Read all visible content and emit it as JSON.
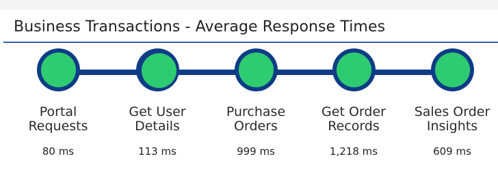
{
  "panel": {
    "title": "Business Transactions - Average Response Times"
  },
  "colors": {
    "accent_rule": "#2f5fa8",
    "node_ring": "#0f3c86",
    "node_fill": "#2ecc71"
  },
  "stages": [
    {
      "label": "Portal\nRequests",
      "value": "80 ms",
      "icon": "status-circle-icon"
    },
    {
      "label": "Get User\nDetails",
      "value": "113 ms",
      "icon": "status-circle-icon"
    },
    {
      "label": "Purchase\nOrders",
      "value": "999 ms",
      "icon": "status-circle-icon"
    },
    {
      "label": "Get Order\nRecords",
      "value": "1,218 ms",
      "icon": "status-circle-icon"
    },
    {
      "label": "Sales Order\nInsights",
      "value": "609 ms",
      "icon": "status-circle-icon"
    }
  ]
}
